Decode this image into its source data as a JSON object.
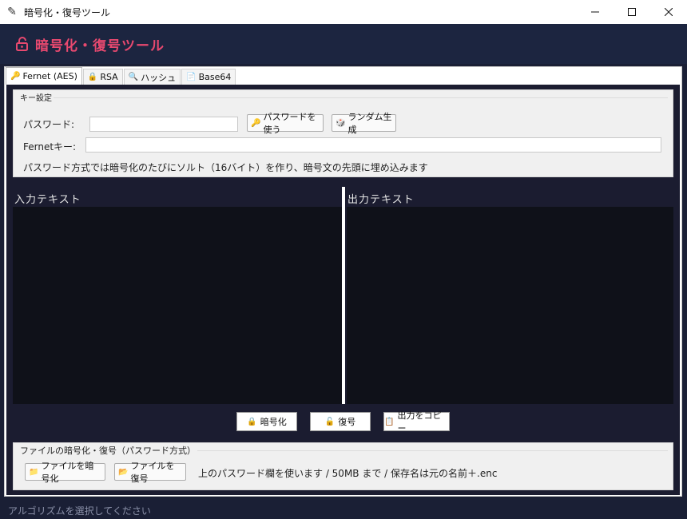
{
  "window": {
    "title": "暗号化・復号ツール",
    "icon": "feather-icon",
    "controls": {
      "minimize": "—",
      "maximize": "☐",
      "close": "✕"
    }
  },
  "header": {
    "title": "暗号化・復号ツール",
    "icon": "unlock-icon",
    "accent_color": "#e8496f"
  },
  "tabs": [
    {
      "label": "Fernet (AES)",
      "icon": "key-icon",
      "glyph": "🔑",
      "active": true
    },
    {
      "label": "RSA",
      "icon": "lock-icon",
      "glyph": "🔒",
      "active": false
    },
    {
      "label": "ハッシュ",
      "icon": "search-icon",
      "glyph": "🔍",
      "active": false
    },
    {
      "label": "Base64",
      "icon": "document-icon",
      "glyph": "📄",
      "active": false
    }
  ],
  "key_settings": {
    "legend": "キー設定",
    "password_label": "パスワード:",
    "password_value": "",
    "use_password_button": "パスワードを使う",
    "random_button": "ランダム生成",
    "fernet_label": "Fernetキー:",
    "fernet_value": "",
    "note": "パスワード方式では暗号化のたびにソルト（16バイト）を作り、暗号文の先頭に埋め込みます"
  },
  "io": {
    "input_label": "入力テキスト",
    "output_label": "出力テキスト",
    "input_value": "",
    "output_value": ""
  },
  "actions": {
    "encrypt": "暗号化",
    "decrypt": "復号",
    "copy": "出力をコピー"
  },
  "file_section": {
    "legend": "ファイルの暗号化・復号（パスワード方式）",
    "encrypt_file": "ファイルを暗号化",
    "decrypt_file": "ファイルを復号",
    "note": "上のパスワード欄を使います / 50MB まで / 保存名は元の名前＋.enc"
  },
  "status": "アルゴリズムを選択してください"
}
